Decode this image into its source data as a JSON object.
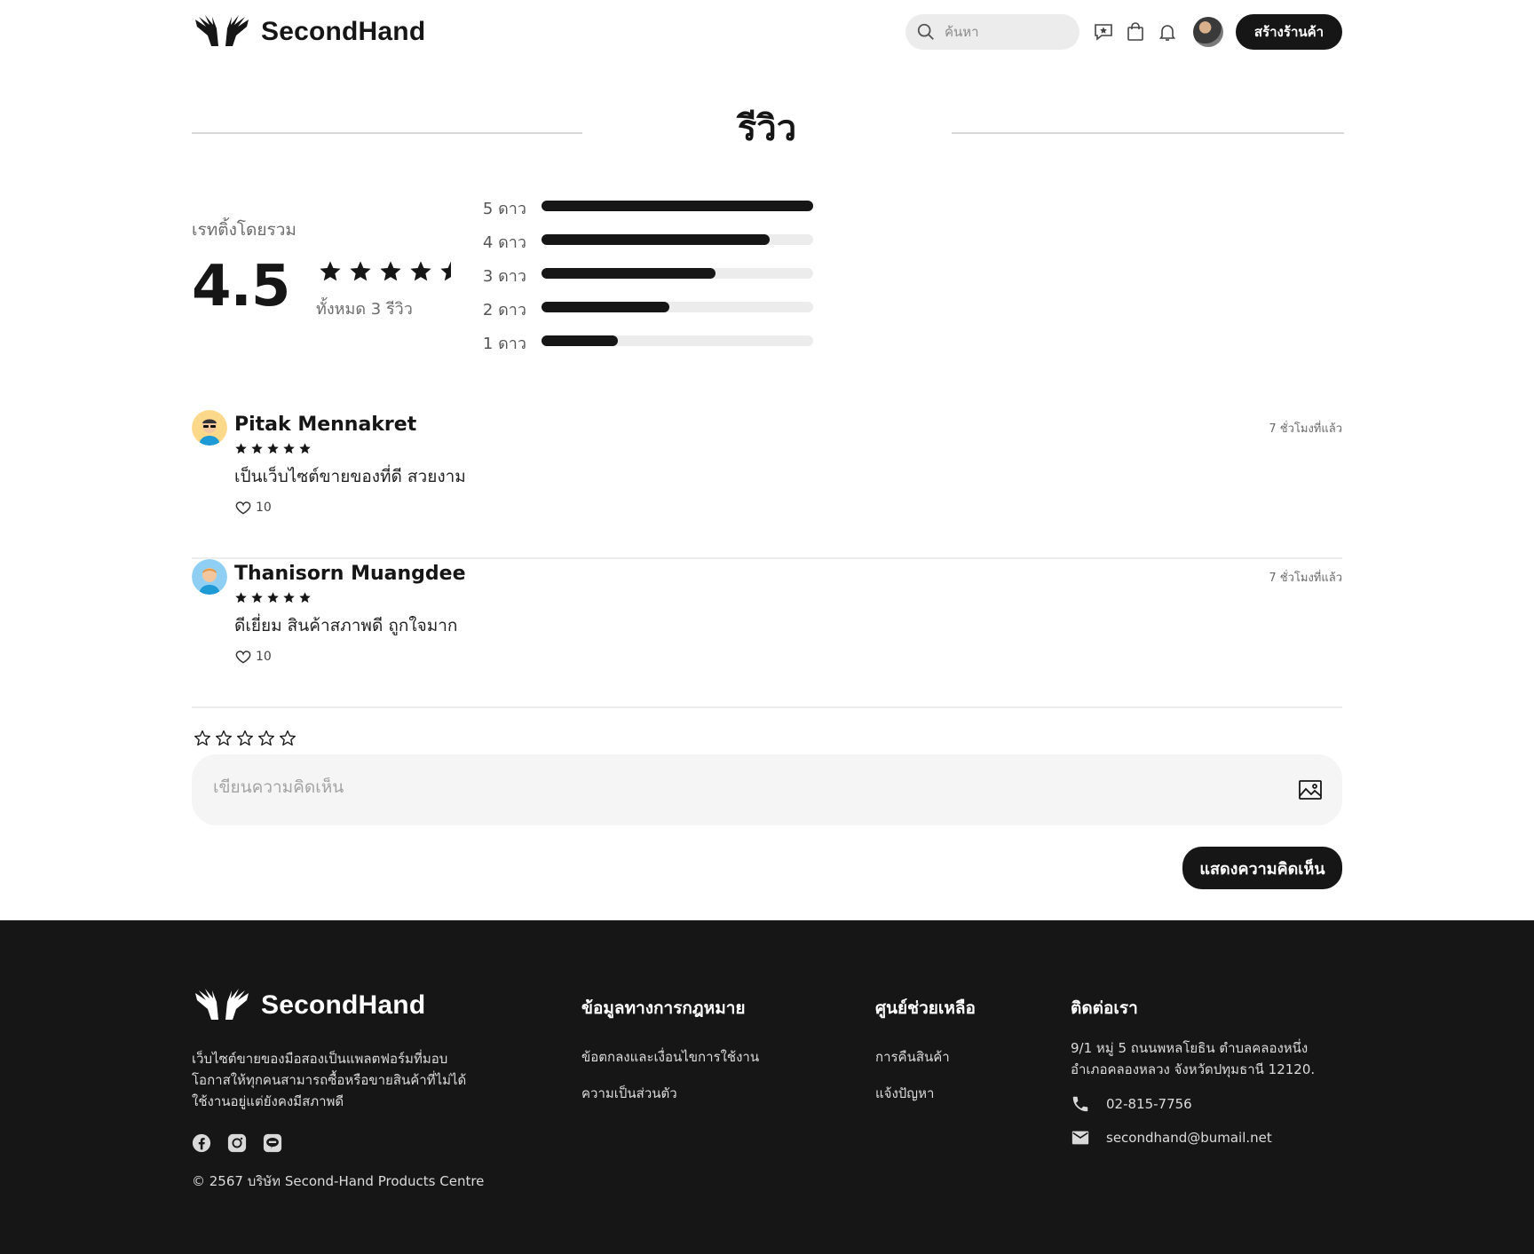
{
  "header": {
    "brand": "SecondHand",
    "search_placeholder": "ค้นหา",
    "create_shop_label": "สร้างร้านค้า",
    "icons": [
      "chat-star-icon",
      "shopping-bag-icon",
      "bell-icon"
    ]
  },
  "section": {
    "title": "รีวิว"
  },
  "summary": {
    "label": "เรทติ้งโดยรวม",
    "score": "4.5",
    "score_value": 4.5,
    "total_text": "ทั้งหมด 3 รีวิว",
    "distribution": [
      {
        "label": "5 ดาว",
        "fraction": 1.0
      },
      {
        "label": "4 ดาว",
        "fraction": 0.84
      },
      {
        "label": "3 ดาว",
        "fraction": 0.64
      },
      {
        "label": "2 ดาว",
        "fraction": 0.47
      },
      {
        "label": "1 ดาว",
        "fraction": 0.28
      }
    ]
  },
  "reviews": [
    {
      "name": "Pitak Mennakret",
      "rating": 5,
      "time": "7 ชั่วโมงที่แล้ว",
      "text": "เป็นเว็บไซต์ขายของที่ดี สวยงาม",
      "likes": "10"
    },
    {
      "name": "Thanisorn Muangdee",
      "rating": 5,
      "time": "7 ชั่วโมงที่แล้ว",
      "text": "ดีเยี่ยม สินค้าสภาพดี ถูกใจมาก",
      "likes": "10"
    }
  ],
  "comment": {
    "placeholder": "เขียนความคิดเห็น",
    "submit_label": "แสดงความคิดเห็น",
    "rating": 0
  },
  "footer": {
    "brand": "SecondHand",
    "description": "เว็บไซต์ขายของมือสองเป็นแพลตฟอร์มที่มอบโอกาสให้ทุกคนสามารถซื้อหรือขายสินค้าที่ไม่ได้ใช้งานอยู่แต่ยังคงมีสภาพดี",
    "copyright": "© 2567 บริษัท Second-Hand Products Centre",
    "social": [
      "facebook-icon",
      "instagram-icon",
      "line-icon"
    ],
    "legal": {
      "title": "ข้อมูลทางการกฎหมาย",
      "links": [
        "ข้อตกลงและเงื่อนไขการใช้งาน",
        "ความเป็นส่วนตัว"
      ]
    },
    "help": {
      "title": "ศูนย์ช่วยเหลือ",
      "links": [
        "การคืนสินค้า",
        "แจ้งปัญหา"
      ]
    },
    "contact": {
      "title": "ติดต่อเรา",
      "address": "9/1 หมู่ 5 ถนนพหลโยธิน ตำบลคลองหนึ่ง อำเภอคลองหลวง จังหวัดปทุมธานี 12120.",
      "phone": "02-815-7756",
      "email": "secondhand@bumail.net"
    }
  },
  "colors": {
    "primary": "#161616",
    "track": "#ececec",
    "footer_bg": "#161616",
    "muted": "#6b6b6b"
  }
}
